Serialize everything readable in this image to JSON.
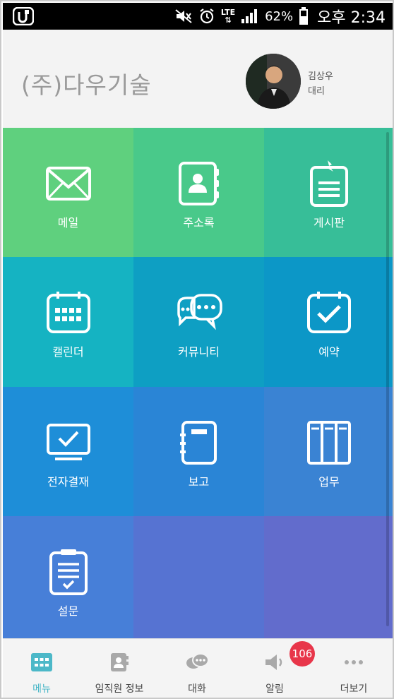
{
  "status_bar": {
    "network": "LTE",
    "battery": "62%",
    "time": "오후 2:34"
  },
  "header": {
    "company": "(주)다우기술",
    "user": {
      "name": "김상우",
      "title": "대리"
    }
  },
  "menu": [
    {
      "label": "메일",
      "icon": "mail-icon",
      "color": "#5fd07e"
    },
    {
      "label": "주소록",
      "icon": "address-book-icon",
      "color": "#49c98a"
    },
    {
      "label": "게시판",
      "icon": "board-icon",
      "color": "#37be98"
    },
    {
      "label": "캘린더",
      "icon": "calendar-icon",
      "color": "#15b3c2"
    },
    {
      "label": "커뮤니티",
      "icon": "community-icon",
      "color": "#0e9fc3"
    },
    {
      "label": "예약",
      "icon": "reservation-icon",
      "color": "#0c97c7"
    },
    {
      "label": "전자결재",
      "icon": "approval-icon",
      "color": "#1e8ed8"
    },
    {
      "label": "보고",
      "icon": "report-icon",
      "color": "#2a85d6"
    },
    {
      "label": "업무",
      "icon": "task-icon",
      "color": "#3a83d3"
    },
    {
      "label": "설문",
      "icon": "survey-icon",
      "color": "#477fd8"
    },
    {
      "label": "",
      "icon": "",
      "color": "#5673d2"
    },
    {
      "label": "",
      "icon": "",
      "color": "#626ccc"
    }
  ],
  "bottom_nav": [
    {
      "label": "메뉴",
      "icon": "grid-menu-icon",
      "active": true
    },
    {
      "label": "임직원 정보",
      "icon": "contacts-icon",
      "active": false
    },
    {
      "label": "대화",
      "icon": "chat-icon",
      "active": false
    },
    {
      "label": "알림",
      "icon": "speaker-icon",
      "active": false
    },
    {
      "label": "더보기",
      "icon": "more-icon",
      "active": false
    }
  ],
  "notification_badge": "106",
  "colors": {
    "accent": "#4cb8c8",
    "badge": "#e8364a"
  }
}
